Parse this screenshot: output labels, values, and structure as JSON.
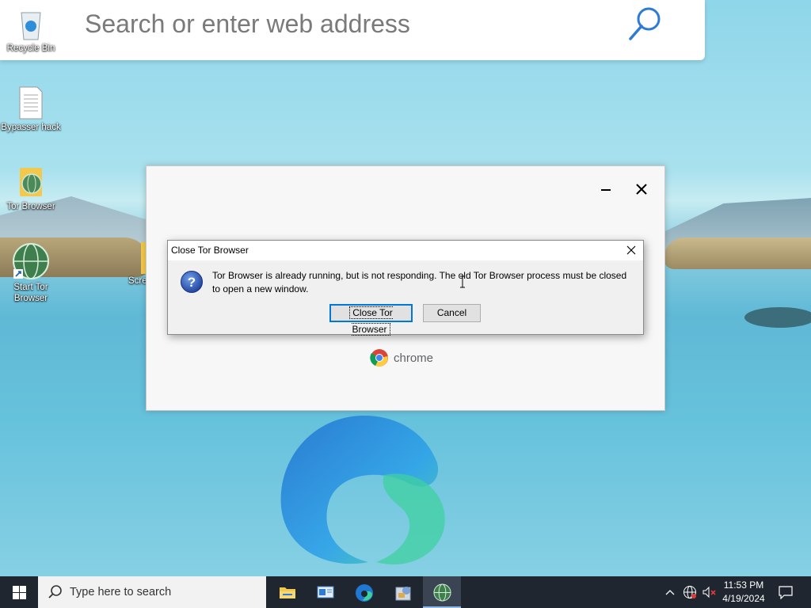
{
  "search_bar": {
    "placeholder": "Search or enter web address"
  },
  "desktop_icons": [
    {
      "label": "Recycle Bin"
    },
    {
      "label": "Bypasser hack"
    },
    {
      "label": "Tor Browser"
    },
    {
      "label_line1": "Start Tor",
      "label_line2": "Browser"
    },
    {
      "label": "Scre"
    }
  ],
  "chrome_window": {
    "brand": "chrome"
  },
  "dialog": {
    "title": "Close Tor Browser",
    "message": "Tor Browser is already running, but is not responding. The old Tor Browser process must be closed to open a new window.",
    "primary_button": "Close Tor Browser",
    "cancel_button": "Cancel"
  },
  "taskbar": {
    "search_placeholder": "Type here to search",
    "time": "11:53 PM",
    "date": "4/19/2024"
  },
  "colors": {
    "taskbar": "#1f2630",
    "accent": "#0078d7"
  }
}
